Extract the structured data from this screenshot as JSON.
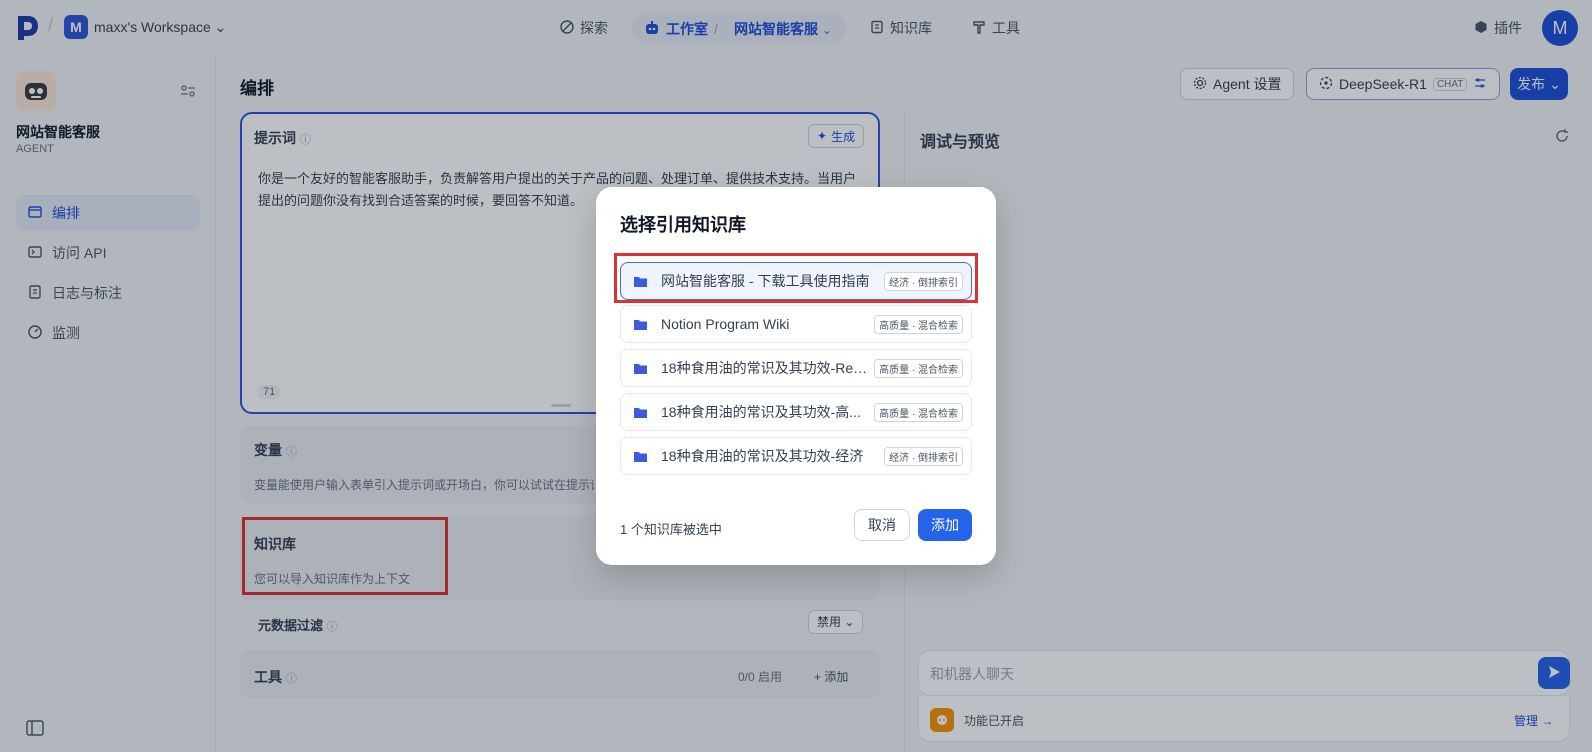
{
  "header": {
    "workspace_initial": "M",
    "workspace_name": "maxx's Workspace",
    "nav_explore": "探索",
    "nav_studio": "工作室",
    "app_crumb": "网站智能客服",
    "nav_knowledge": "知识库",
    "nav_tools": "工具",
    "plugins": "插件",
    "user_initial": "M"
  },
  "sidebar": {
    "app_name": "网站智能客服",
    "app_type": "AGENT",
    "items": [
      {
        "label": "编排",
        "icon": "layout-icon"
      },
      {
        "label": "访问 API",
        "icon": "terminal-icon"
      },
      {
        "label": "日志与标注",
        "icon": "document-icon"
      },
      {
        "label": "监测",
        "icon": "gauge-icon"
      }
    ]
  },
  "main": {
    "title": "编排",
    "agent_settings": "Agent 设置",
    "model_name": "DeepSeek-R1",
    "model_badge": "CHAT",
    "publish": "发布",
    "prompt_label": "提示词",
    "generate": "生成",
    "prompt_text": "你是一个友好的智能客服助手，负责解答用户提出的关于产品的问题、处理订单、提供技术支持。当用户提出的问题你没有找到合适答案的时候，要回答不知道。",
    "prompt_count": "71",
    "variables_label": "变量",
    "variables_desc": "变量能使用户输入表单引入提示词或开场白，你可以试试在提示词",
    "knowledge_label": "知识库",
    "knowledge_desc": "您可以导入知识库作为上下文",
    "metadata_label": "元数据过滤",
    "metadata_value": "禁用",
    "tools_label": "工具",
    "tools_count": "0/0 启用",
    "tools_add": "添加"
  },
  "preview": {
    "title": "调试与预览",
    "chat_placeholder": "和机器人聊天",
    "feature_enabled": "功能已开启",
    "manage": "管理"
  },
  "modal": {
    "title": "选择引用知识库",
    "items": [
      {
        "name": "网站智能客服 - 下载工具使用指南",
        "tag": "经济 · 倒排索引",
        "selected": true
      },
      {
        "name": "Notion Program Wiki",
        "tag": "高质量 · 混合检索",
        "selected": false
      },
      {
        "name": "18种食用油的常识及其功效-Rer...",
        "tag": "高质量 · 混合检索",
        "selected": false
      },
      {
        "name": "18种食用油的常识及其功效-高...",
        "tag": "高质量 · 混合检索",
        "selected": false
      },
      {
        "name": "18种食用油的常识及其功效-经济",
        "tag": "经济 · 倒排索引",
        "selected": false
      }
    ],
    "selected_count": "1 个知识库被选中",
    "cancel": "取消",
    "add": "添加"
  },
  "colors": {
    "accent": "#2563eb",
    "highlight": "#e03131"
  }
}
